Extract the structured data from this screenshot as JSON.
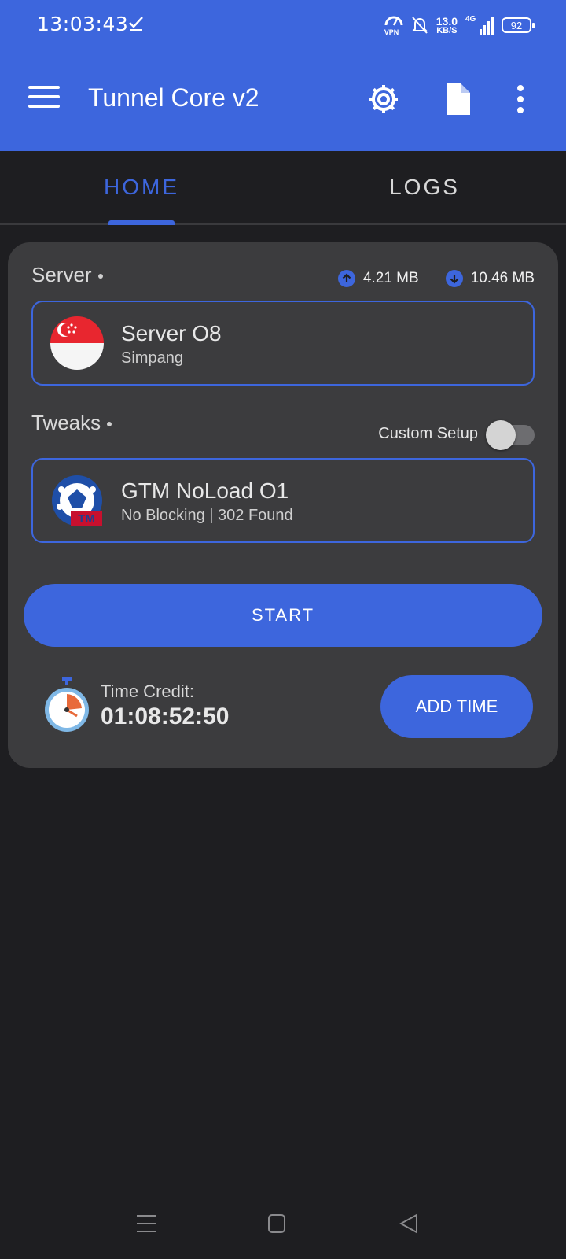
{
  "status": {
    "time": "13:03:43",
    "vpn_label": "VPN",
    "speed_value": "13.0",
    "speed_unit": "KB/S",
    "network": "4G",
    "battery": "92"
  },
  "toolbar": {
    "title": "Tunnel Core v2",
    "menu_icon": "hamburger-menu-icon",
    "settings_icon": "gear-icon",
    "file_icon": "document-icon",
    "overflow_icon": "more-vert-icon"
  },
  "tabs": [
    {
      "label": "HOME",
      "active": true
    },
    {
      "label": "LOGS",
      "active": false
    }
  ],
  "server": {
    "label": "Server",
    "upload": "4.21 MB",
    "download": "10.46 MB",
    "name": "Server O8",
    "location": "Simpang"
  },
  "tweaks": {
    "label": "Tweaks",
    "custom_setup_label": "Custom Setup",
    "custom_setup_on": false,
    "name": "GTM NoLoad O1",
    "detail": "No Blocking | 302 Found",
    "badge": "TM"
  },
  "actions": {
    "start_label": "START",
    "time_credit_label": "Time Credit:",
    "time_credit_value": "01:08:52:50",
    "add_time_label": "ADD TIME"
  },
  "colors": {
    "accent": "#3d66dd",
    "background": "#1e1e21",
    "card": "#3c3c3e"
  }
}
